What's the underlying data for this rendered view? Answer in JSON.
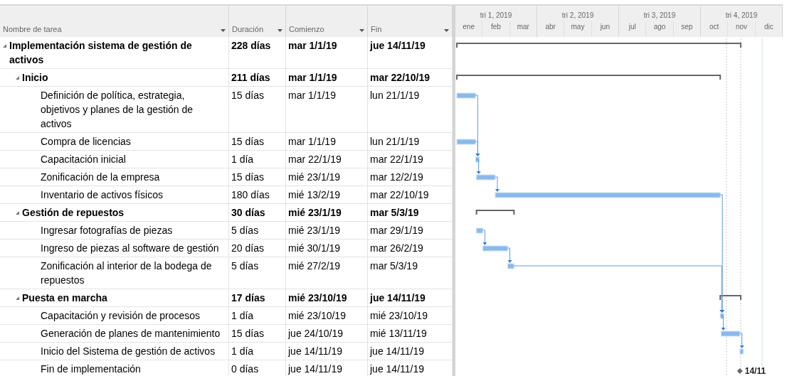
{
  "columns": [
    {
      "label": "Nombre de tarea"
    },
    {
      "label": "Duración"
    },
    {
      "label": "Comienzo"
    },
    {
      "label": "Fin"
    }
  ],
  "timescale": [
    {
      "label": "tri 1, 2019",
      "months": [
        "ene",
        "feb",
        "mar"
      ]
    },
    {
      "label": "tri 2, 2019",
      "months": [
        "abr",
        "may",
        "jun"
      ]
    },
    {
      "label": "tri 3, 2019",
      "months": [
        "jul",
        "ago",
        "sep"
      ]
    },
    {
      "label": "tri 4, 2019",
      "months": [
        "oct",
        "nov",
        "dic"
      ]
    }
  ],
  "tasks": [
    {
      "kind": "summary",
      "expanded": true,
      "name": "Implementación sistema de gestión de activos",
      "duration": "228 días",
      "start": "mar 1/1/19",
      "finish": "jue 14/11/19",
      "children": [
        {
          "kind": "summary",
          "expanded": true,
          "name": "Inicio",
          "duration": "211 días",
          "start": "mar 1/1/19",
          "finish": "mar 22/10/19",
          "children": [
            {
              "kind": "task",
              "name": "Definición de política, estrategia, objetivos y planes de la gestión de activos",
              "duration": "15 días",
              "start": "mar 1/1/19",
              "finish": "lun 21/1/19"
            },
            {
              "kind": "task",
              "name": "Compra de licencias",
              "duration": "15 días",
              "start": "mar 1/1/19",
              "finish": "lun 21/1/19"
            },
            {
              "kind": "task",
              "name": "Capacitación inicial",
              "duration": "1 día",
              "start": "mar 22/1/19",
              "finish": "mar 22/1/19"
            },
            {
              "kind": "task",
              "name": "Zonificación de la empresa",
              "duration": "15 días",
              "start": "mié 23/1/19",
              "finish": "mar 12/2/19"
            },
            {
              "kind": "task",
              "name": "Inventario de activos físicos",
              "duration": "180 días",
              "start": "mié 13/2/19",
              "finish": "mar 22/10/19"
            }
          ]
        },
        {
          "kind": "summary",
          "expanded": true,
          "name": "Gestión de repuestos",
          "duration": "30 días",
          "start": "mié 23/1/19",
          "finish": "mar 5/3/19",
          "children": [
            {
              "kind": "task",
              "name": "Ingresar fotografías de piezas",
              "duration": "5 días",
              "start": "mié 23/1/19",
              "finish": "mar 29/1/19"
            },
            {
              "kind": "task",
              "name": "Ingreso de piezas al software de gestión",
              "duration": "20 días",
              "start": "mié 30/1/19",
              "finish": "mar 26/2/19"
            },
            {
              "kind": "task",
              "name": "Zonificación al interior de la bodega de repuestos",
              "duration": "5 días",
              "start": "mié 27/2/19",
              "finish": "mar 5/3/19"
            }
          ]
        },
        {
          "kind": "summary",
          "expanded": true,
          "name": "Puesta en marcha",
          "duration": "17 días",
          "start": "mié 23/10/19",
          "finish": "jue 14/11/19",
          "children": [
            {
              "kind": "task",
              "name": "Capacitación y revisión de procesos",
              "duration": "1 día",
              "start": "mié 23/10/19",
              "finish": "mié 23/10/19"
            },
            {
              "kind": "task",
              "name": "Generación de planes de mantenimiento",
              "duration": "15 días",
              "start": "jue 24/10/19",
              "finish": "mié 13/11/19"
            },
            {
              "kind": "task",
              "name": "Inicio del Sistema de gestión de activos",
              "duration": "1 día",
              "start": "jue 14/11/19",
              "finish": "jue 14/11/19"
            },
            {
              "kind": "milestone",
              "name": "Fin de implementación",
              "duration": "0 días",
              "start": "jue 14/11/19",
              "finish": "jue 14/11/19",
              "label": "14/11"
            }
          ]
        }
      ]
    }
  ]
}
